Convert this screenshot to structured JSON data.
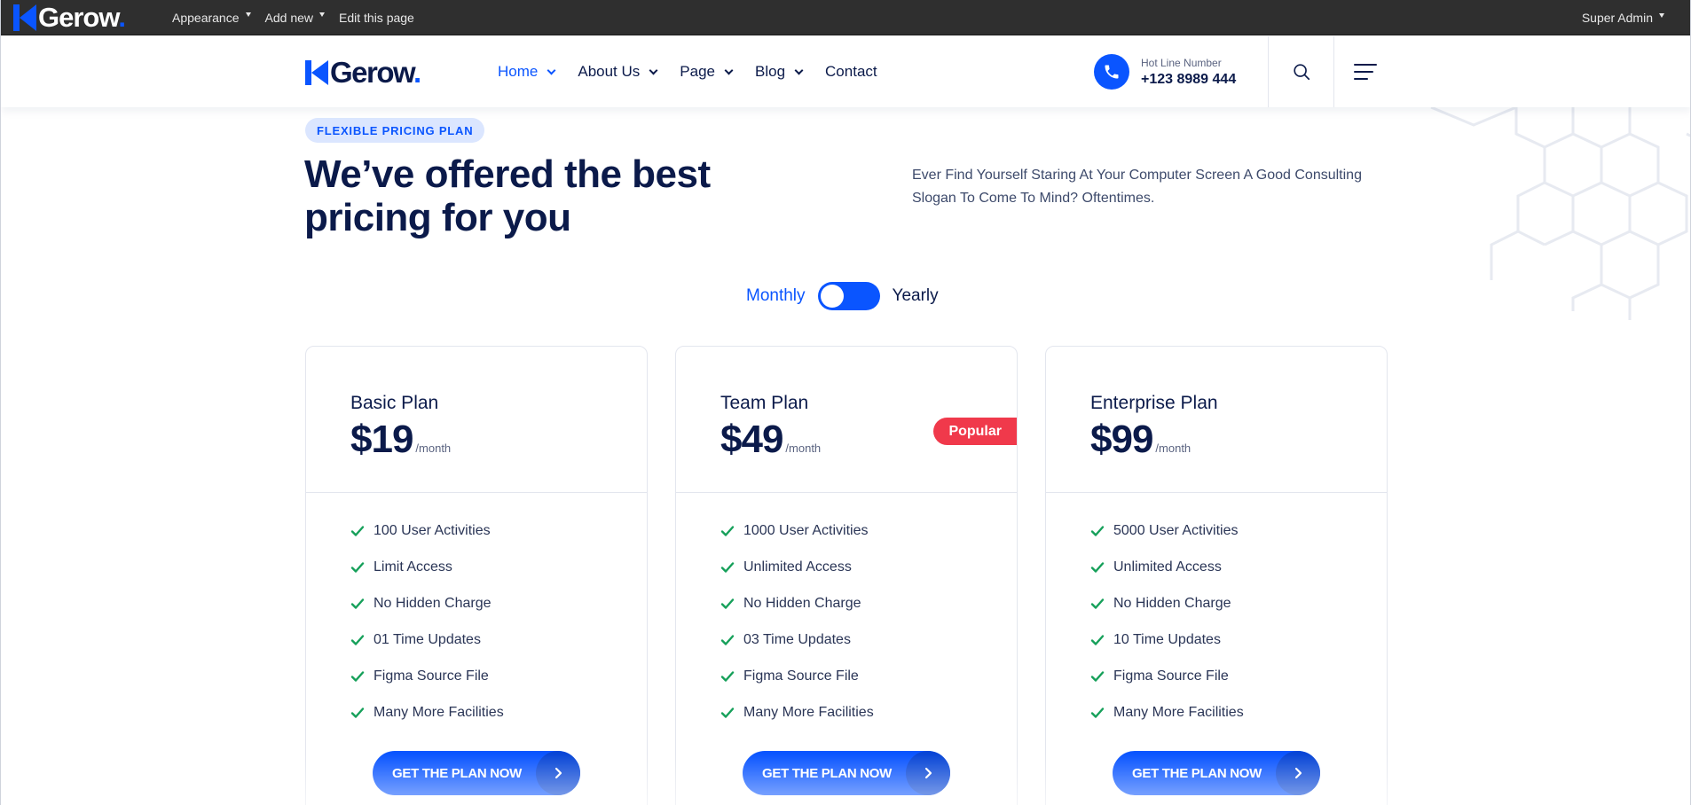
{
  "admin_bar": {
    "brand": "Gerow",
    "brand_dot": ".",
    "menu": [
      {
        "label": "Appearance"
      },
      {
        "label": "Add new"
      },
      {
        "label": "Edit this page"
      }
    ],
    "user": "Super Admin"
  },
  "header": {
    "brand": "Gerow",
    "brand_dot": ".",
    "nav": [
      {
        "label": "Home",
        "active": true
      },
      {
        "label": "About Us"
      },
      {
        "label": "Page"
      },
      {
        "label": "Blog"
      },
      {
        "label": "Contact"
      }
    ],
    "hotline_label": "Hot Line Number",
    "hotline_number": "+123 8989 444"
  },
  "hero": {
    "tag": "FLEXIBLE PRICING PLAN",
    "title": "We’ve offered the best pricing for you",
    "description": "Ever Find Yourself Staring At Your Computer Screen A Good Consulting Slogan To Come To Mind? Oftentimes."
  },
  "billing_toggle": {
    "monthly_label": "Monthly",
    "yearly_label": "Yearly",
    "selected": "Monthly"
  },
  "plans": [
    {
      "name": "Basic Plan",
      "price": "$19",
      "period": "/month",
      "features": [
        "100 User Activities",
        "Limit Access",
        "No Hidden Charge",
        "01 Time Updates",
        "Figma Source File",
        "Many More Facilities"
      ],
      "cta": "GET THE PLAN NOW"
    },
    {
      "name": "Team Plan",
      "price": "$49",
      "period": "/month",
      "badge": "Popular",
      "features": [
        "1000 User Activities",
        "Unlimited Access",
        "No Hidden Charge",
        "03 Time Updates",
        "Figma Source File",
        "Many More Facilities"
      ],
      "cta": "GET THE PLAN NOW"
    },
    {
      "name": "Enterprise Plan",
      "price": "$99",
      "period": "/month",
      "features": [
        "5000 User Activities",
        "Unlimited Access",
        "No Hidden Charge",
        "10 Time Updates",
        "Figma Source File",
        "Many More Facilities"
      ],
      "cta": "GET THE PLAN NOW"
    }
  ],
  "colors": {
    "accent": "#0a55ff",
    "heading": "#0b1a4a",
    "check": "#16a05a",
    "badge": "#f0394b",
    "admin_bar": "#2f2f2f"
  },
  "icons": {
    "phone": "phone-icon",
    "search": "search-icon",
    "menu": "menu-icon",
    "check": "check-icon",
    "arrow": "chevron-right-icon"
  }
}
